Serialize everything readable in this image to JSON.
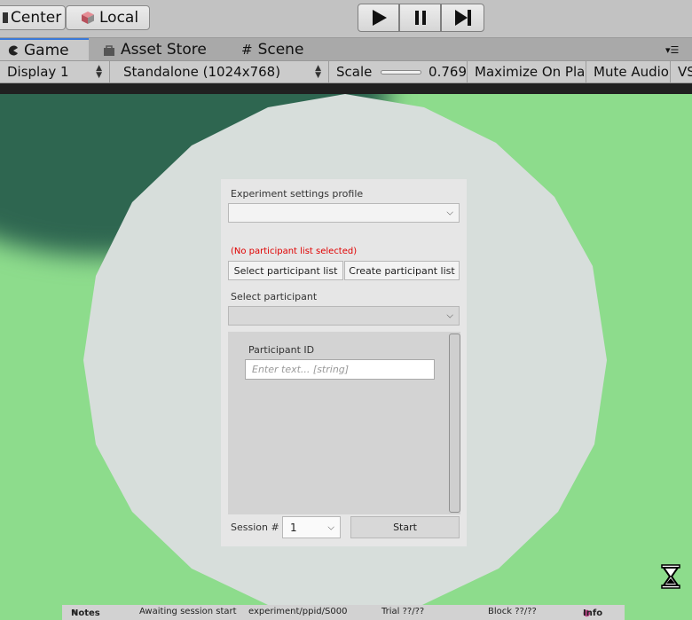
{
  "toolbar": {
    "pivot_label": "Center",
    "space_label": "Local"
  },
  "tabs": [
    {
      "label": "Game",
      "icon": "pacman-icon",
      "active": true
    },
    {
      "label": "Asset Store",
      "icon": "bag-icon",
      "active": false
    },
    {
      "label": "Scene",
      "icon": "grid-icon",
      "active": false
    }
  ],
  "game_controls": {
    "display": "Display 1",
    "resolution": "Standalone (1024x768)",
    "scale_label": "Scale",
    "scale_value": "0.769",
    "maximize": "Maximize On Play",
    "mute": "Mute Audio",
    "stats": "VS"
  },
  "form": {
    "settings_label": "Experiment settings profile",
    "settings_value": "",
    "no_list_msg": "(No participant list selected)",
    "select_list_btn": "Select participant list",
    "create_list_btn": "Create participant list",
    "participant_label": "Select participant",
    "participant_value": "",
    "participant_id_label": "Participant ID",
    "participant_id_placeholder": "Enter text... [string]",
    "session_label": "Session #",
    "session_value": "1",
    "start_btn": "Start"
  },
  "status": {
    "notes": "Notes",
    "state": "Awaiting session start",
    "path": "experiment/ppid/S000",
    "trial": "Trial ??/??",
    "block": "Block ??/??",
    "info": "Info"
  },
  "colors": {
    "ground": "#8ddc8c",
    "disc": "#d7dedb",
    "error_text": "#e00000",
    "active_tab_accent": "#3a79d8"
  }
}
